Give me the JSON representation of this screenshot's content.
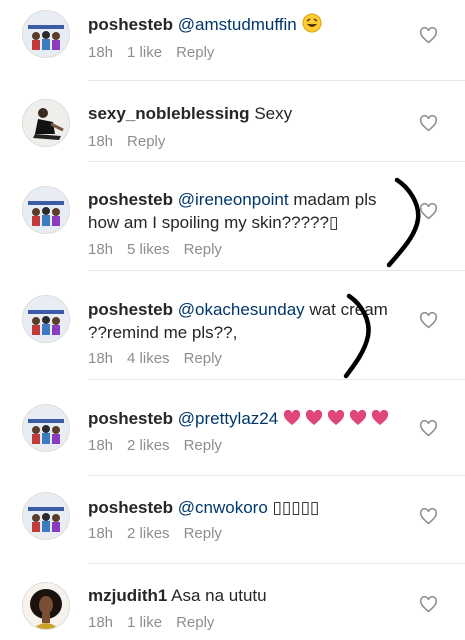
{
  "comments": [
    {
      "username": "poshesteb",
      "mention": "@amstudmuffin",
      "text": "",
      "emoji": "laughing-emoji",
      "time": "18h",
      "likes": "1 like",
      "reply": "Reply"
    },
    {
      "username": "sexy_nobleblessing",
      "mention": "",
      "text": "Sexy",
      "time": "18h",
      "likes": "",
      "reply": "Reply"
    },
    {
      "username": "poshesteb",
      "mention": "@ireneonpoint",
      "text": "madam pls how am I spoiling my skin?????▯",
      "time": "18h",
      "likes": "5 likes",
      "reply": "Reply"
    },
    {
      "username": "poshesteb",
      "mention": "@okachesunday",
      "text": "wat cream ??remind me pls??,",
      "time": "18h",
      "likes": "4 likes",
      "reply": "Reply"
    },
    {
      "username": "poshesteb",
      "mention": "@prettylaz24",
      "text": "",
      "emoji": "hearts-emoji",
      "time": "18h",
      "likes": "2 likes",
      "reply": "Reply"
    },
    {
      "username": "poshesteb",
      "mention": "@cnwokoro",
      "text": "▯▯▯▯▯",
      "time": "18h",
      "likes": "2 likes",
      "reply": "Reply"
    },
    {
      "username": "mzjudith1",
      "mention": "",
      "text": "Asa na ututu",
      "time": "18h",
      "likes": "1 like",
      "reply": "Reply"
    }
  ],
  "colors": {
    "mention": "#00376b",
    "meta": "#8e8e8e",
    "heart_emoji": "#e0457b",
    "scribble": "#000000"
  }
}
